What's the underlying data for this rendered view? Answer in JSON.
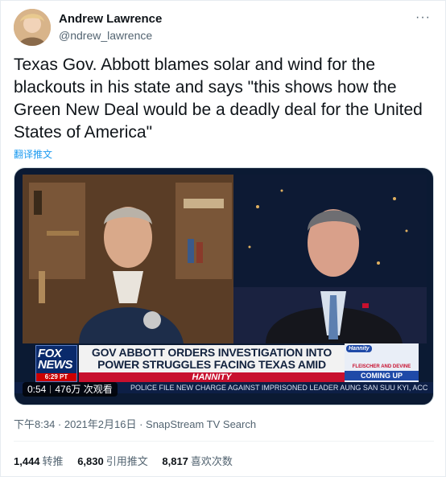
{
  "author": {
    "display_name": "Andrew Lawrence",
    "handle": "@ndrew_lawrence",
    "more_icon": "more-dots-icon"
  },
  "tweet": {
    "text": "Texas Gov. Abbott blames solar and wind for the blackouts in his state and says \"this shows how the Green New Deal would be a deadly deal for the United States of America\"",
    "translate_label": "翻译推文"
  },
  "video": {
    "fox_logo": "FOX NEWS",
    "fox_time": "6:29 PT",
    "headline": "GOV ABBOTT ORDERS INVESTIGATION INTO POWER STRUGGLES FACING TEXAS AMID BLACKOUTS",
    "show_name": "HANNITY",
    "promo_logo": "Hannity",
    "promo_names": "FLEISCHER AND DEVINE",
    "promo_coming": "COMING UP",
    "ticker": "POLICE FILE NEW CHARGE AGAINST IMPRISONED LEADER AUNG SAN SUU KYI, ACC",
    "duration": "0:54",
    "views": "476万 次观看"
  },
  "meta": {
    "timestamp": "下午8:34 · 2021年2月16日",
    "separator": " · ",
    "source": "SnapStream TV Search"
  },
  "stats": {
    "retweets_count": "1,444",
    "retweets_label": "转推",
    "quotes_count": "6,830",
    "quotes_label": "引用推文",
    "likes_count": "8,817",
    "likes_label": "喜欢次数"
  }
}
